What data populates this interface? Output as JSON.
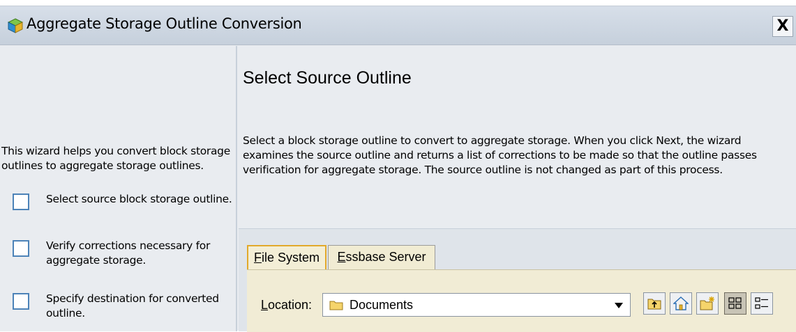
{
  "window": {
    "title": "Aggregate Storage Outline Conversion",
    "close_label": "X",
    "icon": "cube-icon"
  },
  "left": {
    "intro": "This wizard helps you convert block storage outlines to aggregate storage outlines.",
    "steps": [
      {
        "label": "Select source block storage outline.",
        "checked": false
      },
      {
        "label": "Verify corrections necessary for aggregate storage.",
        "checked": false
      },
      {
        "label": "Specify destination for converted outline.",
        "checked": false
      }
    ]
  },
  "main": {
    "title": "Select Source Outline",
    "description": "Select a block storage outline to convert to aggregate storage. When you click Next, the wizard examines the source outline and returns a list of corrections to be made so that the outline passes verification for aggregate storage. The source outline is not changed as part of this process.",
    "tabs": [
      {
        "mnemonic": "F",
        "rest": "ile System",
        "active": true
      },
      {
        "mnemonic": "E",
        "rest": "ssbase Server",
        "active": false
      }
    ],
    "location": {
      "mnemonic": "L",
      "rest": "ocation:",
      "value": "Documents",
      "icon": "folder-icon"
    },
    "toolbar": [
      {
        "name": "up-folder-icon",
        "pressed": false
      },
      {
        "name": "home-icon",
        "pressed": false
      },
      {
        "name": "new-folder-icon",
        "pressed": false
      },
      {
        "name": "list-view-icon",
        "pressed": true
      },
      {
        "name": "details-view-icon",
        "pressed": false
      }
    ]
  },
  "colors": {
    "title_bar": "#c6d0dc",
    "pane_background": "#e9ecf0",
    "tab_panel": "#f1ecd5",
    "active_tab_border": "#e2a92b",
    "checkbox_border": "#4d83b8"
  }
}
